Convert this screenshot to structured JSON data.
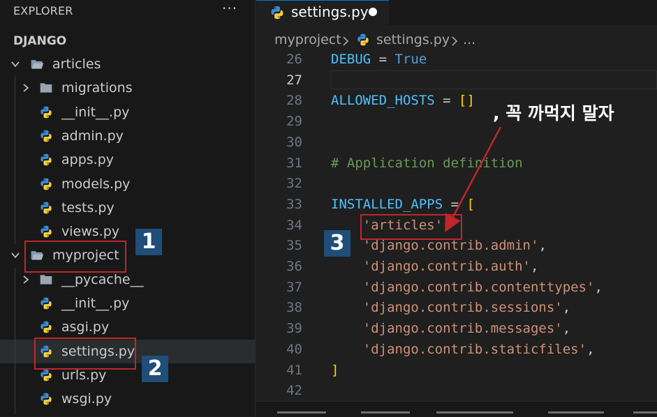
{
  "sidebar": {
    "title": "EXPLORER",
    "more": "···",
    "root": "DJANGO",
    "items": [
      {
        "label": "articles",
        "kind": "folder-open"
      },
      {
        "label": "migrations",
        "kind": "folder-closed"
      },
      {
        "label": "__init__.py",
        "kind": "python"
      },
      {
        "label": "admin.py",
        "kind": "python"
      },
      {
        "label": "apps.py",
        "kind": "python"
      },
      {
        "label": "models.py",
        "kind": "python"
      },
      {
        "label": "tests.py",
        "kind": "python"
      },
      {
        "label": "views.py",
        "kind": "python"
      },
      {
        "label": "myproject",
        "kind": "folder-open"
      },
      {
        "label": "__pycache__",
        "kind": "folder-closed"
      },
      {
        "label": "__init__.py",
        "kind": "python"
      },
      {
        "label": "asgi.py",
        "kind": "python"
      },
      {
        "label": "settings.py",
        "kind": "python",
        "selected": true
      },
      {
        "label": "urls.py",
        "kind": "python"
      },
      {
        "label": "wsgi.py",
        "kind": "python"
      }
    ]
  },
  "editor": {
    "tab": {
      "label": "settings.py",
      "modified": true
    },
    "breadcrumb": {
      "folder": "myproject",
      "file": "settings.py",
      "more": "..."
    },
    "current_line": "27",
    "lines": [
      {
        "n": "26",
        "text": "DEBUG = True"
      },
      {
        "n": "27",
        "text": ""
      },
      {
        "n": "28",
        "text": "ALLOWED_HOSTS = []"
      },
      {
        "n": "29",
        "text": ""
      },
      {
        "n": "30",
        "text": ""
      },
      {
        "n": "31",
        "text": "# Application definition"
      },
      {
        "n": "32",
        "text": ""
      },
      {
        "n": "33",
        "text": "INSTALLED_APPS = ["
      },
      {
        "n": "34",
        "text": "    'articles',"
      },
      {
        "n": "35",
        "text": "    'django.contrib.admin',"
      },
      {
        "n": "36",
        "text": "    'django.contrib.auth',"
      },
      {
        "n": "37",
        "text": "    'django.contrib.contenttypes',"
      },
      {
        "n": "38",
        "text": "    'django.contrib.sessions',"
      },
      {
        "n": "39",
        "text": "    'django.contrib.messages',"
      },
      {
        "n": "40",
        "text": "    'django.contrib.staticfiles',"
      },
      {
        "n": "41",
        "text": "]"
      },
      {
        "n": "42",
        "text": ""
      }
    ]
  },
  "annotations": {
    "badge1": "1",
    "badge2": "2",
    "badge3": "3",
    "note": ", 꼭 까먹지 말자",
    "accent_color": "#c0262c",
    "badge_color": "#1f4e79"
  },
  "colors": {
    "keyword": "#569cd6",
    "variable": "#4fc1ff",
    "string": "#ce9178",
    "comment": "#6a9955",
    "bracket": "#ffd700"
  }
}
